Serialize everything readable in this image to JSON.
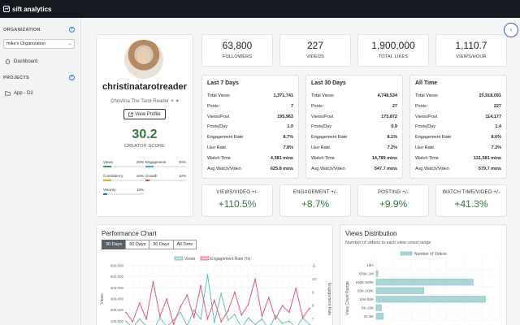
{
  "app": {
    "brand": "sift analytics"
  },
  "sidebar": {
    "organization_heading": "ORGANIZATION",
    "organization_selected": "mike's Organization",
    "dashboard_label": "Dashboard",
    "projects_heading": "PROJECTS",
    "project_item": "App - D2"
  },
  "profile": {
    "username": "christinatarotreader",
    "display_name": "Christina The Tarot Reader",
    "view_profile_label": "View Profile",
    "creator_score": "30.2",
    "creator_score_label": "CREATOR SCORE",
    "metrics": [
      {
        "name": "Views",
        "value": "20%",
        "fraction": 0.2,
        "color": "#22a06b"
      },
      {
        "name": "Engagement",
        "value": "20%",
        "fraction": 0.2,
        "color": "#4aa3df"
      },
      {
        "name": "Consistency",
        "value": "20%",
        "fraction": 0.2,
        "color": "#e2b203"
      },
      {
        "name": "Growth",
        "value": "10%",
        "fraction": 0.1,
        "color": "#e34935"
      },
      {
        "name": "Velocity",
        "value": "10%",
        "fraction": 0.1,
        "color": "#1f6feb"
      }
    ]
  },
  "stats": [
    {
      "value": "63,800",
      "label": "FOLLOWERS"
    },
    {
      "value": "227",
      "label": "VIDEOS"
    },
    {
      "value": "1,900,000",
      "label": "TOTAL LIKES"
    },
    {
      "value": "1,110.7",
      "label": "VIEWS/HOUR"
    }
  ],
  "periods": [
    {
      "title": "Last 7 Days",
      "rows": [
        {
          "label": "Total Views",
          "value": "1,371,741"
        },
        {
          "label": "Posts",
          "value": "7"
        },
        {
          "label": "Views/Post",
          "value": "195,963"
        },
        {
          "label": "Posts/Day",
          "value": "1.0"
        },
        {
          "label": "Engagement Rate",
          "value": "8.7%"
        },
        {
          "label": "Like Rate",
          "value": "7.8%"
        },
        {
          "label": "Watch Time",
          "value": "4,381 mins"
        },
        {
          "label": "Avg Watch/Video",
          "value": "625.8 mins"
        }
      ]
    },
    {
      "title": "Last 30 Days",
      "rows": [
        {
          "label": "Total Views",
          "value": "4,748,534"
        },
        {
          "label": "Posts",
          "value": "27"
        },
        {
          "label": "Views/Post",
          "value": "175,872"
        },
        {
          "label": "Posts/Day",
          "value": "0.9"
        },
        {
          "label": "Engagement Rate",
          "value": "8.1%"
        },
        {
          "label": "Like Rate",
          "value": "7.2%"
        },
        {
          "label": "Watch Time",
          "value": "14,789 mins"
        },
        {
          "label": "Avg Watch/Video",
          "value": "547.7 mins"
        }
      ]
    },
    {
      "title": "All Time",
      "rows": [
        {
          "label": "Total Views",
          "value": "25,918,091"
        },
        {
          "label": "Posts",
          "value": "227"
        },
        {
          "label": "Views/Post",
          "value": "114,177"
        },
        {
          "label": "Posts/Day",
          "value": "1.4"
        },
        {
          "label": "Engagement Rate",
          "value": "8.0%"
        },
        {
          "label": "Like Rate",
          "value": "7.3%"
        },
        {
          "label": "Watch Time",
          "value": "131,581 mins"
        },
        {
          "label": "Avg Watch/Video",
          "value": "579.7 mins"
        }
      ]
    }
  ],
  "changes": [
    {
      "label": "VIEWS/VIDEO +/-",
      "value": "+110.5%"
    },
    {
      "label": "ENGAGEMENT +/-",
      "value": "+8.7%"
    },
    {
      "label": "POSTING +/-",
      "value": "+9.9%"
    },
    {
      "label": "WATCH TIME/VIDEO +/-",
      "value": "+41.3%"
    }
  ],
  "performance_chart": {
    "title": "Performance Chart",
    "tabs": [
      "30 Days",
      "60 Days",
      "90 Days",
      "All Time"
    ],
    "active_tab": "30 Days",
    "legend": [
      "Views",
      "Engagement Rate (%)"
    ]
  },
  "views_distribution": {
    "title": "Views Distribution",
    "subtitle": "Number of videos in each view count range",
    "legend": "Number of Videos"
  },
  "chart_data": [
    {
      "type": "line",
      "title": "",
      "xlabel": "",
      "ylabel": "Views",
      "y2label": "Engagement Rate",
      "y_ticks": [
        "600,000",
        "500,000",
        "400,000",
        "300,000",
        "200,000",
        "100,000"
      ],
      "y2_ticks": [
        "11",
        "10",
        "9",
        "8",
        "7"
      ],
      "ylim": [
        0,
        600000
      ],
      "y2lim": [
        6,
        11
      ],
      "series": [
        {
          "name": "Views",
          "color": "#6cbcc0",
          "values": [
            100000,
            40000,
            120000,
            60000,
            20000,
            130000,
            50000,
            110000,
            180000,
            60000,
            200000,
            120000,
            520000,
            90000,
            350000,
            110000,
            160000,
            40000,
            130000,
            70000,
            120000,
            30000,
            150000,
            80000,
            100000,
            40000,
            130000,
            70000
          ]
        },
        {
          "name": "Engagement Rate (%)",
          "color": "#e05a75",
          "values": [
            7.5,
            6.8,
            8.2,
            7.0,
            9.8,
            7.2,
            8.5,
            6.6,
            7.9,
            8.8,
            7.1,
            9.5,
            7.0,
            8.4,
            6.8,
            7.6,
            9.0,
            7.3,
            8.1,
            10.0,
            7.2,
            8.6,
            7.0,
            8.0,
            7.5,
            9.3,
            7.1,
            7.8
          ]
        }
      ]
    },
    {
      "type": "bar",
      "orientation": "horizontal",
      "title": "Views Distribution",
      "ylabel": "View Count Range",
      "series_name": "Number of Videos",
      "categories": [
        "1M+",
        "500K-1M",
        "100K-500K",
        "50K-100K",
        "10K-50K",
        "5K-10K",
        "1K-5K"
      ],
      "values": [
        0,
        1,
        55,
        27,
        62,
        3,
        4
      ]
    }
  ]
}
